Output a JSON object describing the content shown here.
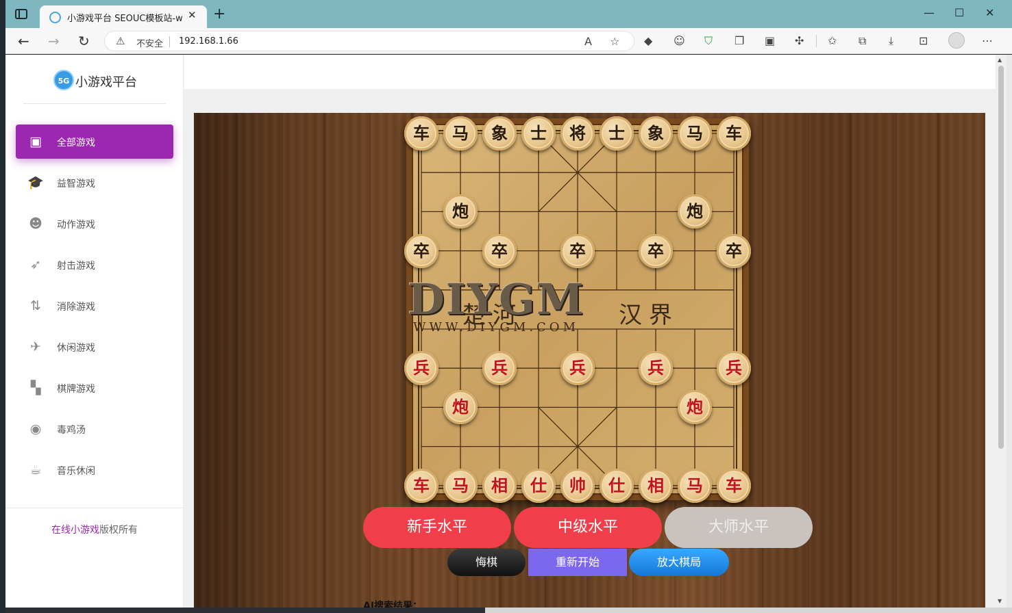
{
  "browser": {
    "tab_title": "小游戏平台 SEOUC模板站-www.seouc.com",
    "insecure_label": "不安全",
    "url": "192.168.1.66"
  },
  "sidebar": {
    "logo_badge": "5G",
    "logo_text": "小游戏平台",
    "items": [
      {
        "label": "全部游戏",
        "icon": "twitch-icon",
        "active": true
      },
      {
        "label": "益智游戏",
        "icon": "graduation-cap-icon"
      },
      {
        "label": "动作游戏",
        "icon": "reddit-icon"
      },
      {
        "label": "射击游戏",
        "icon": "rocket-icon"
      },
      {
        "label": "消除游戏",
        "icon": "arrows-icon"
      },
      {
        "label": "休闲游戏",
        "icon": "bird-icon"
      },
      {
        "label": "棋牌游戏",
        "icon": "checkerboard-icon"
      },
      {
        "label": "毒鸡汤",
        "icon": "user-circle-icon"
      },
      {
        "label": "音乐休闲",
        "icon": "coffee-cup-icon"
      }
    ],
    "copyright_highlight": "在线小游戏",
    "copyright_rest": "版权所有"
  },
  "game": {
    "watermark_logo": "DIYGM",
    "watermark_url": "WWW.DIYGM.COM",
    "river_left": "楚河",
    "river_right": "汉界",
    "black_back_row": [
      "车",
      "马",
      "象",
      "士",
      "将",
      "士",
      "象",
      "马",
      "车"
    ],
    "black_cannon": "炮",
    "black_pawn": "卒",
    "red_back_row": [
      "车",
      "马",
      "相",
      "仕",
      "帅",
      "仕",
      "相",
      "马",
      "车"
    ],
    "red_cannon": "炮",
    "red_pawn": "兵",
    "level_buttons": [
      "新手水平",
      "中级水平",
      "大师水平"
    ],
    "undo_label": "悔棋",
    "restart_label": "重新开始",
    "zoom_label": "放大棋局",
    "ai_result_label": "AI搜索结果："
  }
}
